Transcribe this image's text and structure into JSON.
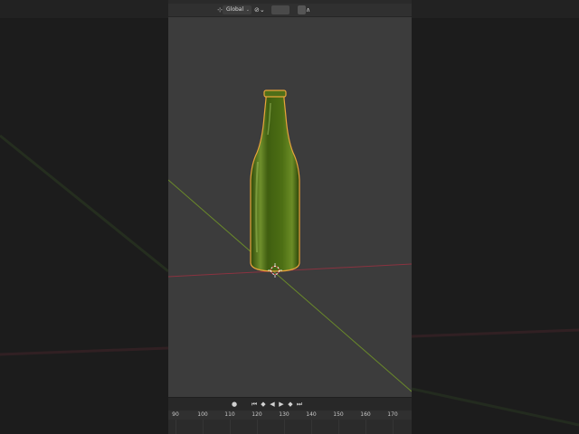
{
  "header": {
    "orientation": "Global",
    "pivot_icon": "pivot-point-icon",
    "snap_icon": "magnet-icon",
    "falloff_icon": "proportional-falloff-icon"
  },
  "timeline": {
    "frames": [
      "90",
      "100",
      "110",
      "120",
      "130",
      "140",
      "150",
      "160",
      "170"
    ],
    "buttons": [
      "record-icon",
      "jump-start-icon",
      "prev-keyframe-icon",
      "play-reverse-icon",
      "play-icon",
      "next-keyframe-icon",
      "jump-end-icon"
    ]
  },
  "colors": {
    "viewport_bg": "#3c3c3c",
    "bottle": "#4a6d12",
    "selection_outline": "#e8a33a",
    "x_axis": "#8a3340",
    "y_axis": "#6a8a2a"
  }
}
